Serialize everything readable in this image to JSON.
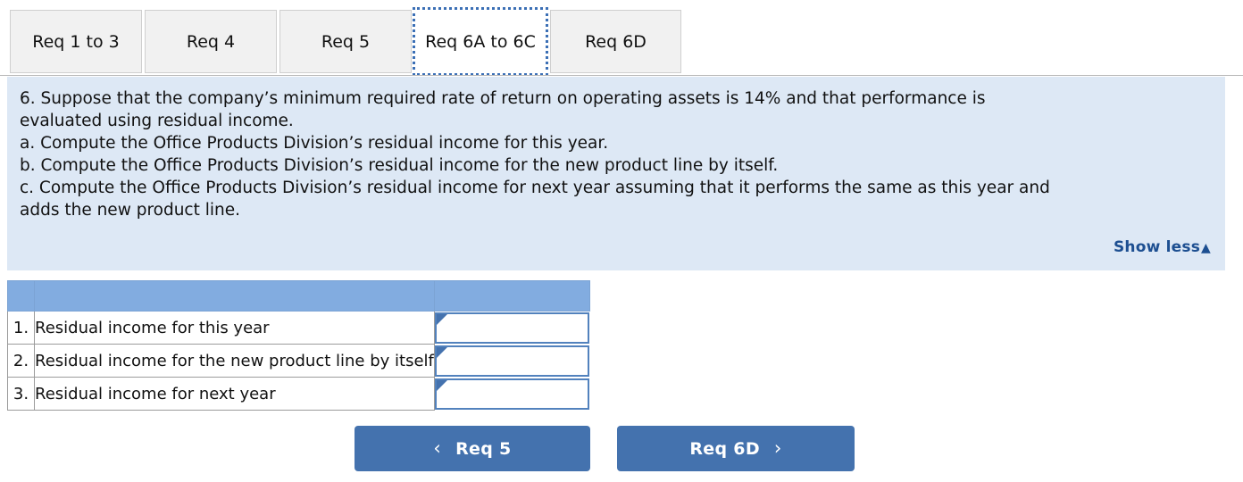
{
  "tabs": [
    {
      "label": "Req 1 to 3",
      "active": false
    },
    {
      "label": "Req 4",
      "active": false
    },
    {
      "label": "Req 5",
      "active": false
    },
    {
      "label": "Req 6A to 6C",
      "active": true
    },
    {
      "label": "Req 6D",
      "active": false
    }
  ],
  "instructions": {
    "line1": "6. Suppose that the company’s minimum required rate of return on operating assets is 14% and that performance is",
    "line2": "evaluated using residual income.",
    "line3": "a. Compute the Office Products Division’s residual income for this year.",
    "line4": "b. Compute the Office Products Division’s residual income for the new product line by itself.",
    "line5": "c. Compute the Office Products Division’s residual income for next year assuming that it performs the same as this year and",
    "line6": "adds the new product line.",
    "show_less_label": "Show less",
    "show_less_caret": "▲"
  },
  "answer_table": {
    "header": {
      "col_num": "",
      "col_label": "",
      "col_input": ""
    },
    "rows": [
      {
        "num": "1.",
        "label": "Residual income for this year",
        "value": ""
      },
      {
        "num": "2.",
        "label": "Residual income for the new product line by itself",
        "value": ""
      },
      {
        "num": "3.",
        "label": "Residual income for next year",
        "value": ""
      }
    ]
  },
  "nav": {
    "prev_label": "Req 5",
    "prev_icon": "‹",
    "next_label": "Req 6D",
    "next_icon": "›"
  },
  "colors": {
    "panel_bg": "#dde8f5",
    "table_header_blue": "#82ACE0",
    "button_blue": "#4472AE",
    "link_blue": "#1d4f91",
    "focus_outline": "#3b6fb5"
  }
}
